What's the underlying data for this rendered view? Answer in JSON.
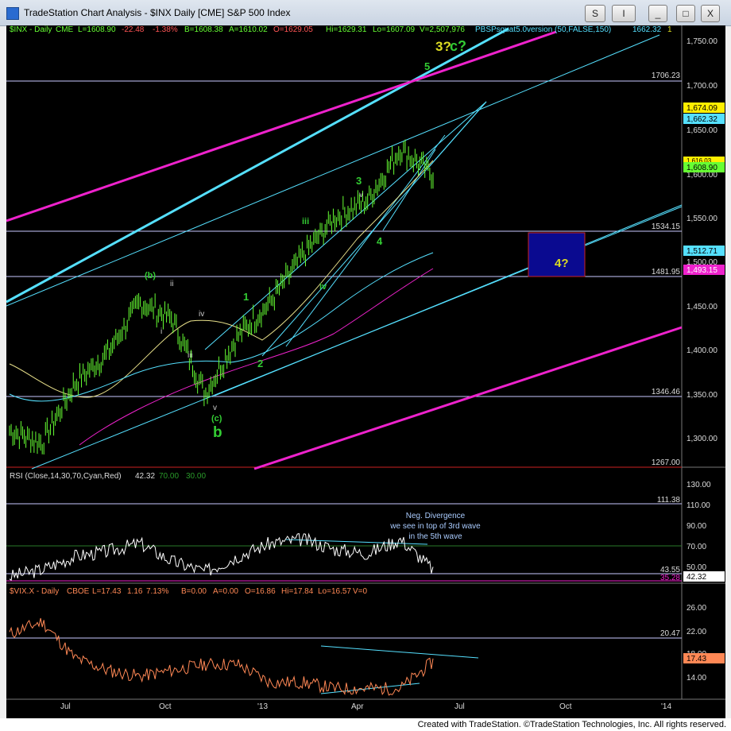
{
  "window": {
    "title": "TradeStation Chart Analysis - $INX Daily [CME] S&P 500 Index",
    "buttons": [
      "S",
      "I",
      "_",
      "□",
      "X"
    ]
  },
  "price_panel": {
    "header": [
      "$INX - Daily",
      "CME",
      "L=1608.90",
      "-22.48",
      "-1.38%",
      "B=1608.38",
      "A=1610.02",
      "O=1629.05",
      "Hi=1629.31",
      "Lo=1607.09",
      "V=2,507,976",
      "PBSPsquat5.0version (50,FALSE,150)",
      "1662.32",
      "1"
    ],
    "axis_ticks": [
      "1,750.00",
      "1,700.00",
      "1,650.00",
      "1,600.00",
      "1,550.00",
      "1,500.00",
      "1,450.00",
      "1,400.00",
      "1,350.00",
      "1,300.00"
    ],
    "level_labels": [
      "1706.23",
      "1534.15",
      "1481.95",
      "1346.46",
      "1267.00"
    ],
    "price_tags": [
      "1,674.09",
      "1,662.32",
      "1,616.03",
      "1,608.90",
      "1,512.71",
      "1,493.15"
    ],
    "wave_labels": {
      "c_major": "c?",
      "three_major": "3?",
      "five": "5",
      "three": "3",
      "v_small": "v",
      "iii": "iii",
      "iv": "iv",
      "four": "4",
      "one": "1",
      "two": "2",
      "b_minor": "(b)",
      "ii": "ii",
      "i": "i",
      "iii_b": "iii",
      "iv_b": "iv",
      "v_b": "v",
      "c_minor": "(c)",
      "b_major": "b",
      "four_q": "4?"
    }
  },
  "rsi_panel": {
    "header": [
      "RSI (Close,14,30,70,Cyan,Red)",
      "42.32",
      "70.00",
      "30.00"
    ],
    "axis_ticks": [
      "130.00",
      "110.00",
      "90.00",
      "70.00",
      "50.00"
    ],
    "level_labels": [
      "111.38",
      "43.55",
      "35.28"
    ],
    "value_tag": "42.32",
    "annotation": [
      "Neg. Divergence",
      "we see in top of 3rd wave",
      "in the 5th wave"
    ]
  },
  "vix_panel": {
    "header": [
      "$VIX.X - Daily",
      "CBOE",
      "L=17.43",
      "1.16",
      "7.13%",
      "B=0.00",
      "A=0.00",
      "O=16.86",
      "Hi=17.84",
      "Lo=16.57",
      "V=0"
    ],
    "axis_ticks": [
      "26.00",
      "22.00",
      "18.00",
      "14.00"
    ],
    "level_labels": [
      "20.47"
    ],
    "value_tag": "17.43"
  },
  "x_axis": [
    "Jul",
    "Oct",
    "'13",
    "Apr",
    "Jul",
    "Oct",
    "'14"
  ],
  "footer": "Created with TradeStation. ©TradeStation Technologies, Inc. All rights reserved.",
  "colors": {
    "background": "#000000",
    "bars": "#66ff33",
    "cyan": "#55e0ff",
    "magenta": "#ee22cc",
    "yellow_ma": "#e8e08a",
    "wave_green": "#33cc33",
    "wave_yellow": "#dddd22",
    "vix": "#ff8855",
    "box_fill": "#0a0a90",
    "box_border": "#cc2222"
  },
  "chart_data": [
    {
      "type": "line",
      "title": "$INX Daily [CME] S&P 500 Index",
      "x": [
        "2012-05",
        "2012-06",
        "2012-07",
        "2012-08",
        "2012-09",
        "2012-10",
        "2012-11",
        "2012-12",
        "2013-01",
        "2013-02",
        "2013-03",
        "2013-04",
        "2013-05",
        "2013-06"
      ],
      "series": [
        {
          "name": "$INX",
          "values": [
            1310,
            1295,
            1365,
            1400,
            1460,
            1440,
            1353,
            1420,
            1460,
            1515,
            1560,
            1580,
            1640,
            1609
          ]
        }
      ],
      "ylim": [
        1267,
        1770
      ],
      "horizontal_levels": [
        1706.23,
        1534.15,
        1481.95,
        1346.46,
        1267.0
      ],
      "last": 1608.9,
      "open": 1629.05,
      "high": 1629.31,
      "low": 1607.09,
      "change": -22.48,
      "change_pct": -1.38
    },
    {
      "type": "line",
      "title": "RSI (Close,14,30,70,Cyan,Red)",
      "x": [
        "2012-05",
        "2012-06",
        "2012-07",
        "2012-08",
        "2012-09",
        "2012-10",
        "2012-11",
        "2012-12",
        "2013-01",
        "2013-02",
        "2013-03",
        "2013-04",
        "2013-05",
        "2013-06"
      ],
      "series": [
        {
          "name": "RSI",
          "values": [
            35,
            42,
            55,
            60,
            68,
            50,
            40,
            55,
            68,
            72,
            62,
            58,
            72,
            42
          ]
        }
      ],
      "ylim": [
        30,
        130
      ],
      "horizontal_levels": [
        111.38,
        43.55,
        35.28
      ],
      "last": 42.32
    },
    {
      "type": "line",
      "title": "$VIX.X - Daily CBOE",
      "x": [
        "2012-05",
        "2012-06",
        "2012-07",
        "2012-08",
        "2012-09",
        "2012-10",
        "2012-11",
        "2012-12",
        "2013-01",
        "2013-02",
        "2013-03",
        "2013-04",
        "2013-05",
        "2013-06"
      ],
      "series": [
        {
          "name": "$VIX.X",
          "values": [
            22,
            24,
            18,
            16,
            15,
            16,
            17,
            17,
            14,
            14,
            13,
            13,
            13,
            17.43
          ]
        }
      ],
      "ylim": [
        11.5,
        28
      ],
      "horizontal_levels": [
        20.47
      ],
      "last": 17.43,
      "open": 16.86,
      "high": 17.84,
      "low": 16.57,
      "change": 1.16,
      "change_pct": 7.13
    }
  ]
}
